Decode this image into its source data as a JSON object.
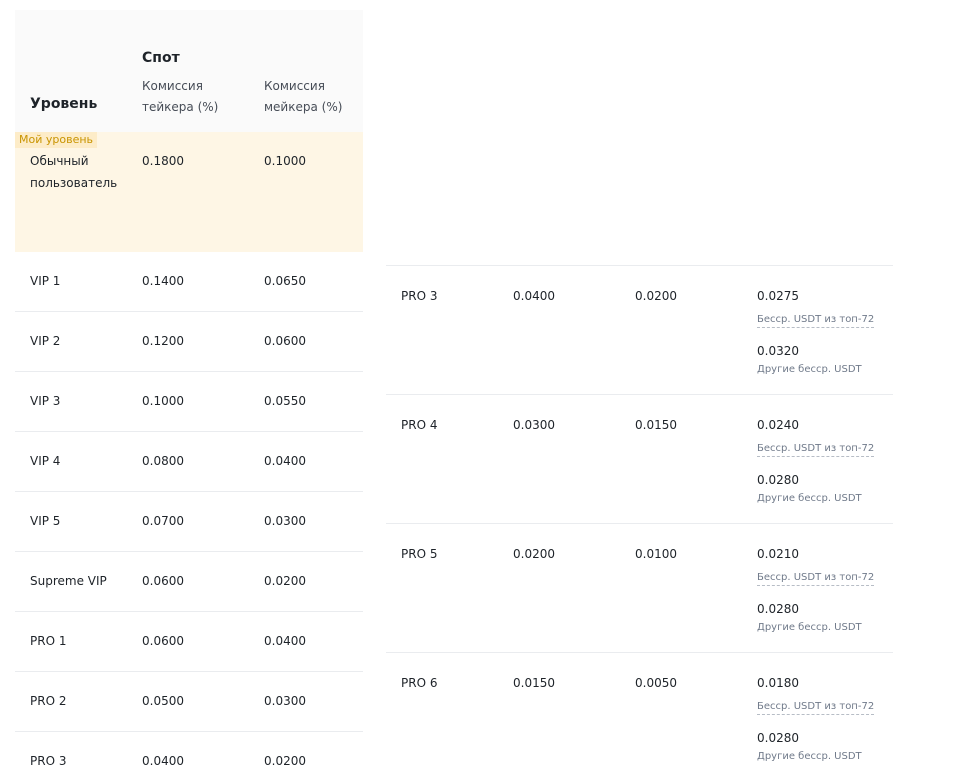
{
  "header": {
    "level": "Уровень",
    "spot": "Спот",
    "taker": "Комиссия тейкера (%)",
    "maker": "Комиссия мейкера (%)"
  },
  "my_level_badge": "Мой уровень",
  "my_row": {
    "level": "Обычный пользователь",
    "taker": "0.1800",
    "maker": "0.1000"
  },
  "rows": [
    {
      "level": "VIP 1",
      "taker": "0.1400",
      "maker": "0.0650"
    },
    {
      "level": "VIP 2",
      "taker": "0.1200",
      "maker": "0.0600"
    },
    {
      "level": "VIP 3",
      "taker": "0.1000",
      "maker": "0.0550"
    },
    {
      "level": "VIP 4",
      "taker": "0.0800",
      "maker": "0.0400"
    },
    {
      "level": "VIP 5",
      "taker": "0.0700",
      "maker": "0.0300"
    },
    {
      "level": "Supreme VIP",
      "taker": "0.0600",
      "maker": "0.0200"
    },
    {
      "level": "PRO 1",
      "taker": "0.0600",
      "maker": "0.0400"
    },
    {
      "level": "PRO 2",
      "taker": "0.0500",
      "maker": "0.0300"
    },
    {
      "level": "PRO 3",
      "taker": "0.0400",
      "maker": "0.0200"
    }
  ],
  "pro_rows": [
    {
      "level": "PRO 3",
      "taker": "0.0400",
      "maker": "0.0200",
      "fee_top": "0.0275",
      "fee_top_label": "Бесср. USDT из топ-72",
      "fee_other": "0.0320",
      "fee_other_label": "Другие бесср. USDT"
    },
    {
      "level": "PRO 4",
      "taker": "0.0300",
      "maker": "0.0150",
      "fee_top": "0.0240",
      "fee_top_label": "Бесср. USDT из топ-72",
      "fee_other": "0.0280",
      "fee_other_label": "Другие бесср. USDT"
    },
    {
      "level": "PRO 5",
      "taker": "0.0200",
      "maker": "0.0100",
      "fee_top": "0.0210",
      "fee_top_label": "Бесср. USDT из топ-72",
      "fee_other": "0.0280",
      "fee_other_label": "Другие бесср. USDT"
    },
    {
      "level": "PRO 6",
      "taker": "0.0150",
      "maker": "0.0050",
      "fee_top": "0.0180",
      "fee_top_label": "Бесср. USDT из топ-72",
      "fee_other": "0.0280",
      "fee_other_label": "Другие бесср. USDT"
    }
  ]
}
